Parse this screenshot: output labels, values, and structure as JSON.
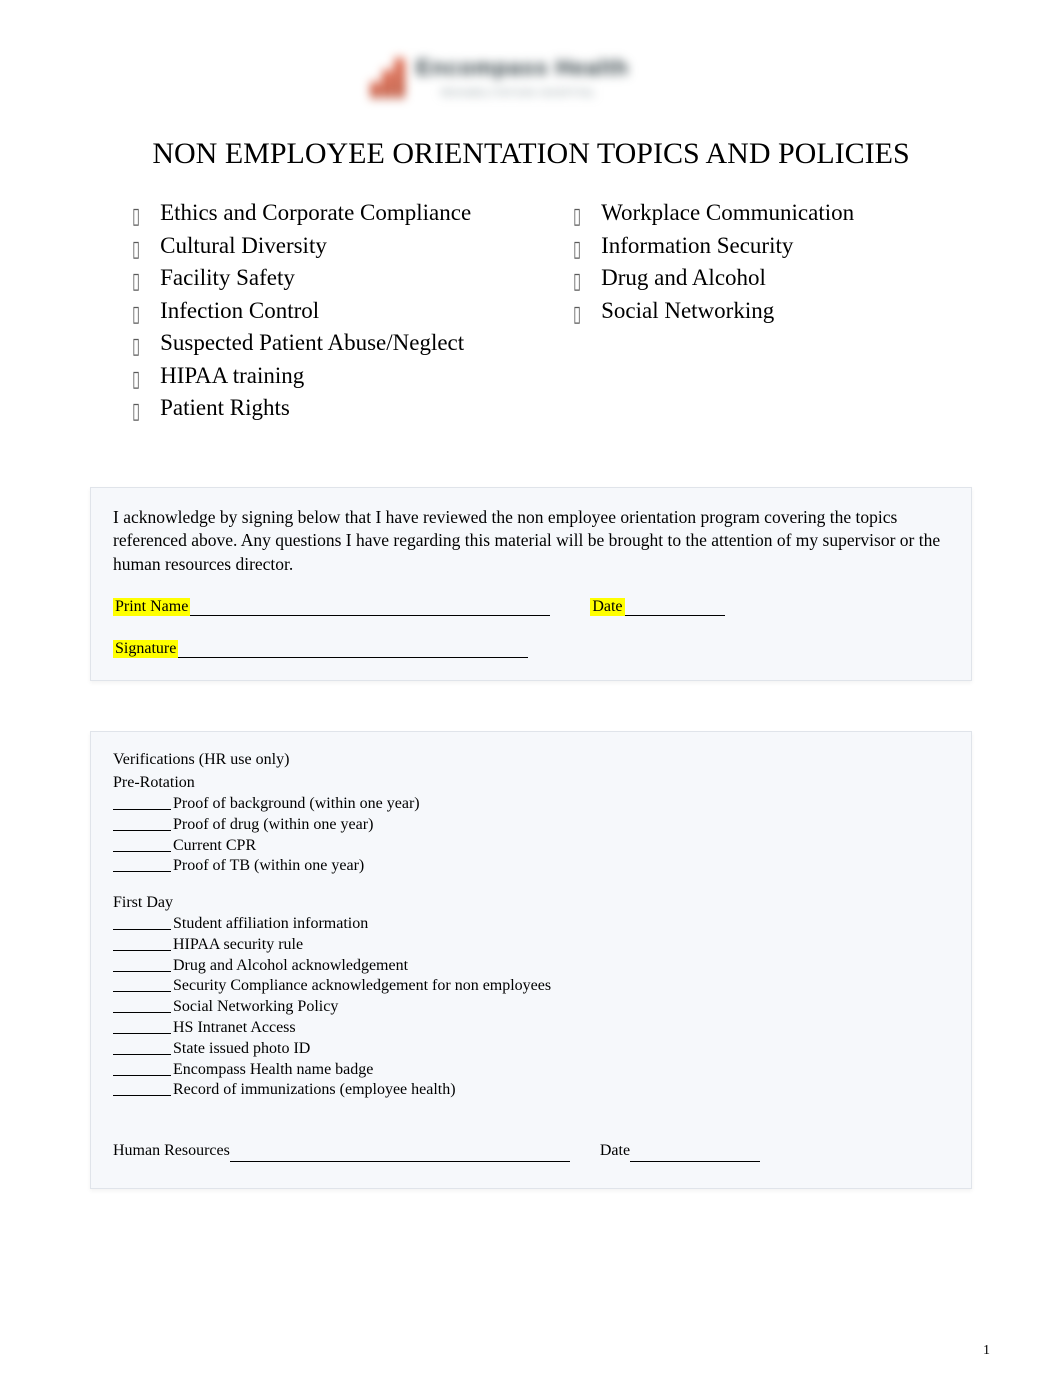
{
  "logo": {
    "brand_top": "Encompass Health",
    "brand_sub": "REHABILITATION HOSPITAL"
  },
  "title": "NON EMPLOYEE ORIENTATION TOPICS AND POLICIES",
  "topics_left": [
    "Ethics and Corporate Compliance",
    "Cultural Diversity",
    "Facility Safety",
    "Infection Control",
    "Suspected Patient Abuse/Neglect",
    "HIPAA training",
    "Patient Rights"
  ],
  "topics_right": [
    "Workplace Communication",
    "Information Security",
    "Drug and Alcohol",
    "Social Networking"
  ],
  "acknowledgement": {
    "text": "I acknowledge by signing below that I have reviewed the non employee orientation program covering the topics referenced above.   Any questions I have regarding this material will be brought to the attention of my supervisor or the human resources director.",
    "print_name_label": "Print Name",
    "date_label": "Date",
    "signature_label": "Signature"
  },
  "verifications": {
    "heading": "Verifications (HR use only)",
    "pre_rotation_label": "Pre-Rotation",
    "pre_rotation_items": [
      "Proof of background (within one year)",
      "Proof of drug (within one year)",
      "Current CPR",
      "Proof of TB (within one year)"
    ],
    "first_day_label": "First Day",
    "first_day_items": [
      "Student affiliation information",
      "HIPAA security rule",
      "Drug and Alcohol acknowledgement",
      "Security Compliance acknowledgement for non employees",
      "Social Networking Policy",
      "HS Intranet Access",
      "State issued photo ID",
      "Encompass Health name badge",
      "Record of immunizations (employee health)"
    ],
    "hr_label": "Human Resources",
    "hr_date_label": "Date"
  },
  "page_number": "1"
}
